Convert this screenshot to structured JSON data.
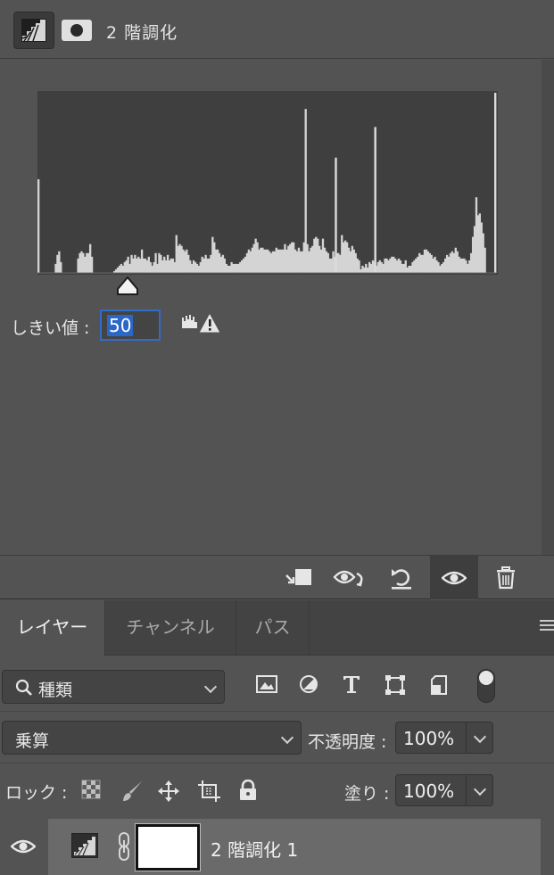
{
  "properties": {
    "title": "2 階調化",
    "threshold_label": "しきい値 :",
    "threshold_value": "50",
    "slider_fraction": 0.196,
    "footer_buttons": [
      "clip-to-layer-icon",
      "view-previous-state-icon",
      "reset-icon",
      "visibility-eye-icon",
      "trash-icon"
    ]
  },
  "chart_data": {
    "type": "bar",
    "title": "",
    "xlabel": "",
    "ylabel": "",
    "xlim": [
      0,
      255
    ],
    "ylim": [
      0,
      100
    ],
    "values": [
      52,
      0,
      0,
      0,
      0,
      0,
      0,
      0,
      0,
      0,
      5,
      10,
      12,
      6,
      0,
      0,
      0,
      0,
      0,
      0,
      0,
      0,
      0,
      8,
      11,
      12,
      11,
      9,
      11,
      11,
      16,
      9,
      0,
      0,
      0,
      0,
      0,
      0,
      0,
      0,
      0,
      0,
      0,
      0,
      1,
      2,
      3,
      4,
      5,
      4,
      6,
      7,
      9,
      5,
      10,
      8,
      10,
      8,
      9,
      8,
      13,
      8,
      8,
      7,
      9,
      6,
      4,
      6,
      11,
      5,
      11,
      10,
      7,
      9,
      7,
      10,
      7,
      8,
      8,
      6,
      21,
      15,
      16,
      15,
      13,
      12,
      13,
      10,
      7,
      5,
      7,
      6,
      5,
      4,
      6,
      9,
      8,
      10,
      8,
      8,
      10,
      20,
      17,
      13,
      13,
      11,
      9,
      10,
      8,
      5,
      4,
      4,
      6,
      5,
      5,
      5,
      5,
      6,
      7,
      8,
      9,
      11,
      13,
      12,
      14,
      16,
      19,
      17,
      13,
      14,
      14,
      13,
      13,
      13,
      12,
      11,
      12,
      12,
      14,
      13,
      13,
      13,
      13,
      16,
      13,
      15,
      16,
      17,
      17,
      13,
      12,
      14,
      12,
      12,
      17,
      91,
      16,
      12,
      14,
      15,
      19,
      20,
      19,
      15,
      13,
      19,
      14,
      12,
      11,
      8,
      8,
      12,
      9,
      11,
      11,
      10,
      21,
      17,
      18,
      17,
      14,
      12,
      15,
      13,
      11,
      8,
      7,
      2,
      4,
      3,
      5,
      3,
      6,
      5,
      7,
      6,
      4,
      6,
      7,
      6,
      5,
      8,
      8,
      7,
      8,
      9,
      9,
      8,
      7,
      8,
      7,
      5,
      5,
      7,
      3,
      4,
      4,
      6,
      7,
      8,
      9,
      11,
      10,
      10,
      13,
      13,
      12,
      11,
      10,
      8,
      9,
      7,
      6,
      4,
      5,
      6,
      8,
      10,
      9,
      11,
      12,
      11,
      14,
      12,
      9,
      8,
      8,
      8,
      7,
      5,
      7,
      11,
      20,
      26,
      42,
      32,
      33,
      28,
      22,
      14,
      0,
      0,
      0,
      0,
      0,
      0
    ],
    "spikes": [
      {
        "x": 166,
        "value": 64
      },
      {
        "x": 188,
        "value": 81
      },
      {
        "x": 255,
        "value": 100
      }
    ],
    "grid": false
  },
  "layers_panel": {
    "tabs": [
      "レイヤー",
      "チャンネル",
      "パス"
    ],
    "active_tab": 0,
    "filter_label": "種類",
    "filter_icons": [
      "image-filter-icon",
      "adjustment-filter-icon",
      "type-filter-icon",
      "shape-filter-icon",
      "smart-object-filter-icon"
    ],
    "blend_mode": "乗算",
    "opacity_label": "不透明度 :",
    "opacity_value": "100%",
    "lock_label": "ロック :",
    "fill_label": "塗り :",
    "fill_value": "100%",
    "layer": {
      "name": "2 階調化 1",
      "visible": true
    }
  }
}
